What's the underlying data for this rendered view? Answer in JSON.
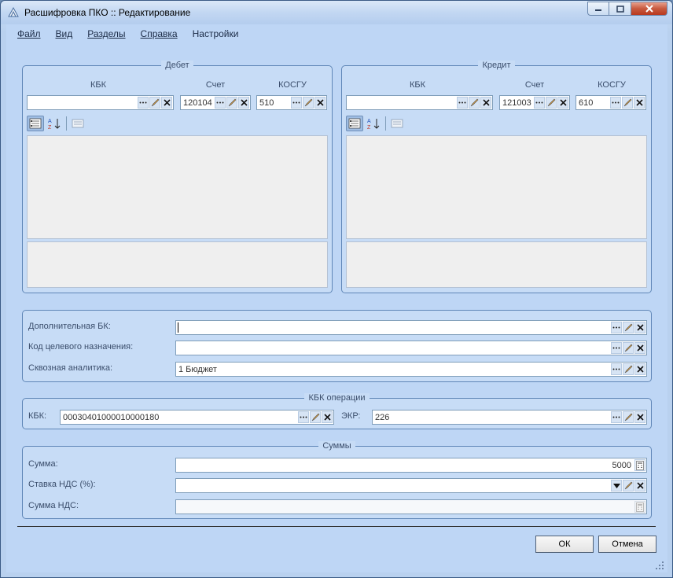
{
  "window": {
    "title": "Расшифровка ПКО :: Редактирование"
  },
  "menu": [
    {
      "label": "Файл"
    },
    {
      "label": "Вид"
    },
    {
      "label": "Разделы"
    },
    {
      "label": "Справка"
    },
    {
      "label": "Настройки"
    }
  ],
  "debet": {
    "legend": "Дебет",
    "kbk_label": "КБК",
    "schet_label": "Счет",
    "kosgu_label": "КОСГУ",
    "kbk_value": "",
    "schet_value": "120104",
    "kosgu_value": "510"
  },
  "kredit": {
    "legend": "Кредит",
    "kbk_label": "КБК",
    "schet_label": "Счет",
    "kosgu_label": "КОСГУ",
    "kbk_value": "",
    "schet_value": "121003",
    "kosgu_value": "610"
  },
  "extra": {
    "dop_bk_label": "Дополнительная БК:",
    "dop_bk_value": "",
    "kod_label": "Код целевого назначения:",
    "kod_value": "",
    "skv_label": "Сквозная аналитика:",
    "skv_value": "1 Бюджет"
  },
  "kbk_op": {
    "legend": "КБК операции",
    "kbk_label": "КБК:",
    "kbk_value": "00030401000010000180",
    "ekr_label": "ЭКР:",
    "ekr_value": "226"
  },
  "sums": {
    "legend": "Суммы",
    "summa_label": "Сумма:",
    "summa_value": "5000",
    "nds_rate_label": "Ставка НДС (%):",
    "nds_rate_value": "",
    "nds_sum_label": "Сумма НДС:",
    "nds_sum_value": ""
  },
  "buttons": {
    "ok": "ОК",
    "cancel": "Отмена"
  }
}
